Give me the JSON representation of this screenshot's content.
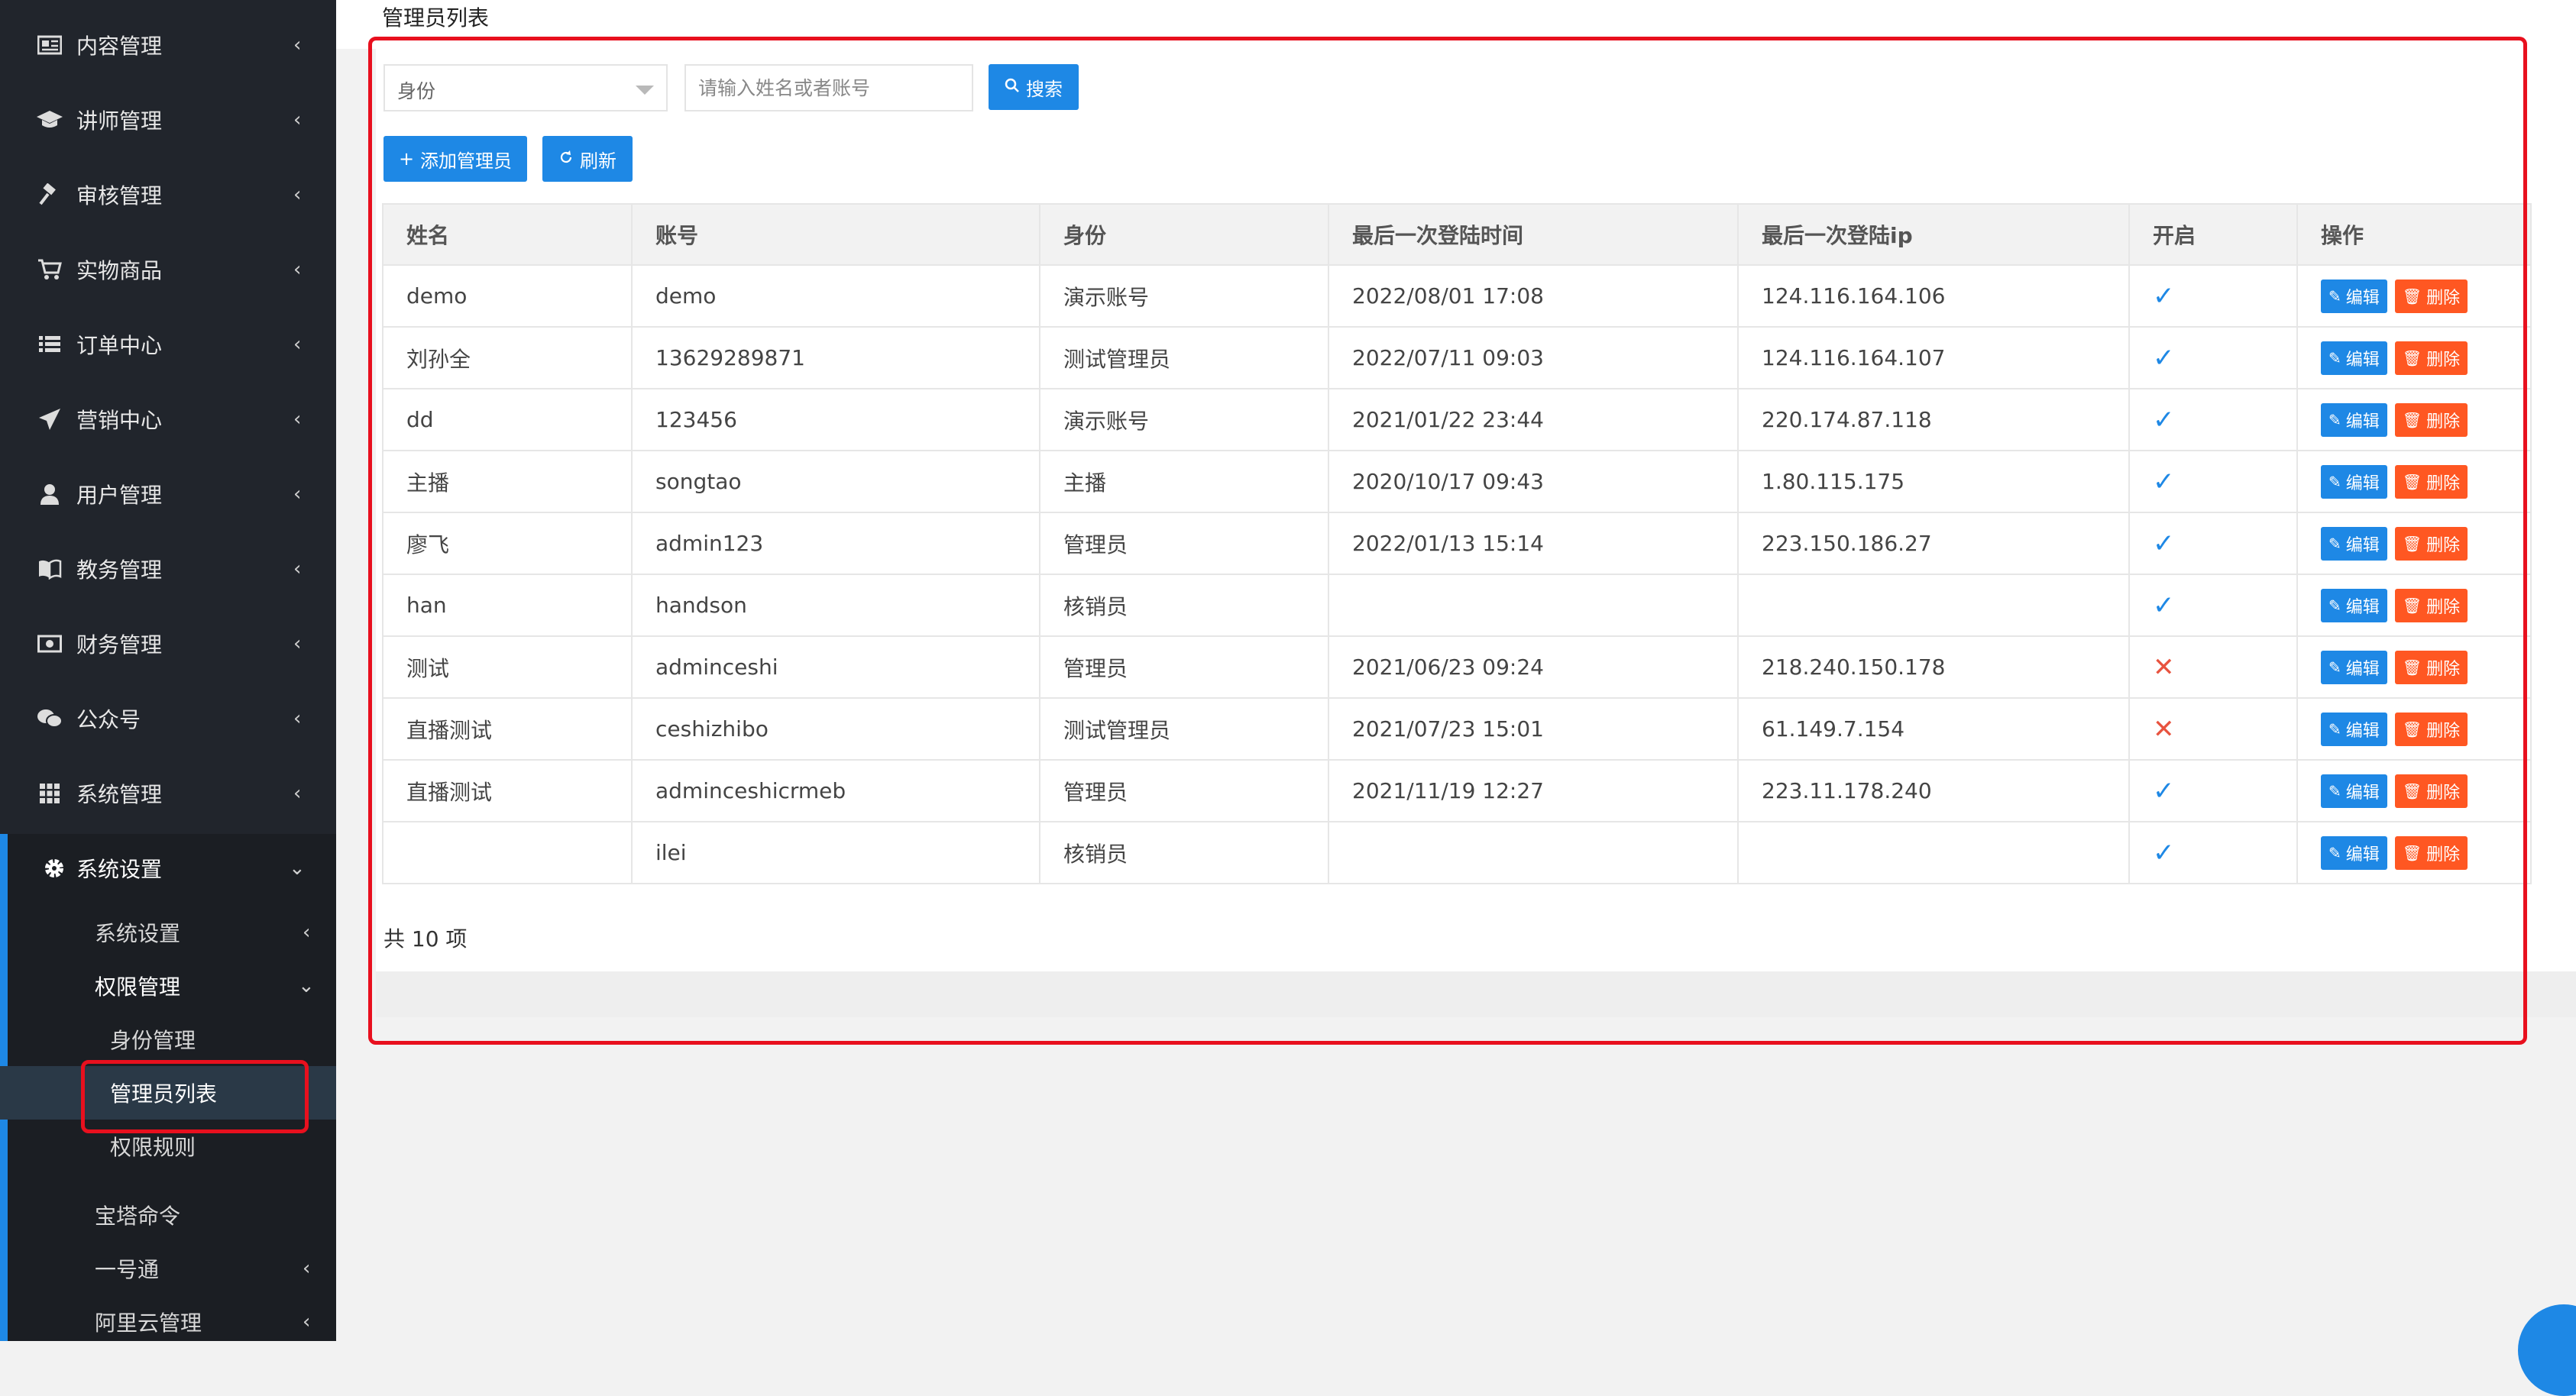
{
  "sidebar": {
    "items": [
      {
        "label": "内容管理",
        "icon": "newspaper-icon"
      },
      {
        "label": "讲师管理",
        "icon": "graduation-cap-icon"
      },
      {
        "label": "审核管理",
        "icon": "gavel-icon"
      },
      {
        "label": "实物商品",
        "icon": "cart-icon"
      },
      {
        "label": "订单中心",
        "icon": "list-icon"
      },
      {
        "label": "营销中心",
        "icon": "send-icon"
      },
      {
        "label": "用户管理",
        "icon": "user-icon"
      },
      {
        "label": "教务管理",
        "icon": "book-icon"
      },
      {
        "label": "财务管理",
        "icon": "money-icon"
      },
      {
        "label": "公众号",
        "icon": "wechat-icon"
      },
      {
        "label": "系统管理",
        "icon": "grid-icon"
      },
      {
        "label": "系统设置",
        "icon": "gear-icon"
      }
    ],
    "submenu": {
      "system_settings": "系统设置",
      "permission": "权限管理",
      "role": "身份管理",
      "admin_list": "管理员列表",
      "rules": "权限规则",
      "bt_command": "宝塔命令",
      "yihaotong": "一号通",
      "aliyun": "阿里云管理"
    }
  },
  "header": {
    "title": "管理员列表"
  },
  "filters": {
    "role_select": "身份",
    "search_placeholder": "请输入姓名或者账号",
    "search_button": "搜索"
  },
  "toolbar": {
    "add_label": "添加管理员",
    "refresh_label": "刷新"
  },
  "table": {
    "columns": [
      "姓名",
      "账号",
      "身份",
      "最后一次登陆时间",
      "最后一次登陆ip",
      "开启",
      "操作"
    ],
    "edit_label": "编辑",
    "delete_label": "删除",
    "rows": [
      {
        "name": "demo",
        "account": "demo",
        "role": "演示账号",
        "last_login": "2022/08/01 17:08",
        "ip": "124.116.164.106",
        "enabled": true
      },
      {
        "name": "刘孙全",
        "account": "13629289871",
        "role": "测试管理员",
        "last_login": "2022/07/11 09:03",
        "ip": "124.116.164.107",
        "enabled": true
      },
      {
        "name": "dd",
        "account": "123456",
        "role": "演示账号",
        "last_login": "2021/01/22 23:44",
        "ip": "220.174.87.118",
        "enabled": true
      },
      {
        "name": "主播",
        "account": "songtao",
        "role": "主播",
        "last_login": "2020/10/17 09:43",
        "ip": "1.80.115.175",
        "enabled": true
      },
      {
        "name": "廖飞",
        "account": "admin123",
        "role": "管理员",
        "last_login": "2022/01/13 15:14",
        "ip": "223.150.186.27",
        "enabled": true
      },
      {
        "name": "han",
        "account": "handson",
        "role": "核销员",
        "last_login": "",
        "ip": "",
        "enabled": true
      },
      {
        "name": "测试",
        "account": "adminceshi",
        "role": "管理员",
        "last_login": "2021/06/23 09:24",
        "ip": "218.240.150.178",
        "enabled": false
      },
      {
        "name": "直播测试",
        "account": "ceshizhibo",
        "role": "测试管理员",
        "last_login": "2021/07/23 15:01",
        "ip": "61.149.7.154",
        "enabled": false
      },
      {
        "name": "直播测试",
        "account": "adminceshicrmeb",
        "role": "管理员",
        "last_login": "2021/11/19 12:27",
        "ip": "223.11.178.240",
        "enabled": true
      },
      {
        "name": "",
        "account": "ilei",
        "role": "核销员",
        "last_login": "",
        "ip": "",
        "enabled": true
      }
    ]
  },
  "footer": {
    "total": "共 10 项"
  },
  "colors": {
    "primary": "#1e88e5",
    "danger": "#ff5722",
    "highlight": "#e8101e",
    "sidebar_bg": "#21252c"
  }
}
